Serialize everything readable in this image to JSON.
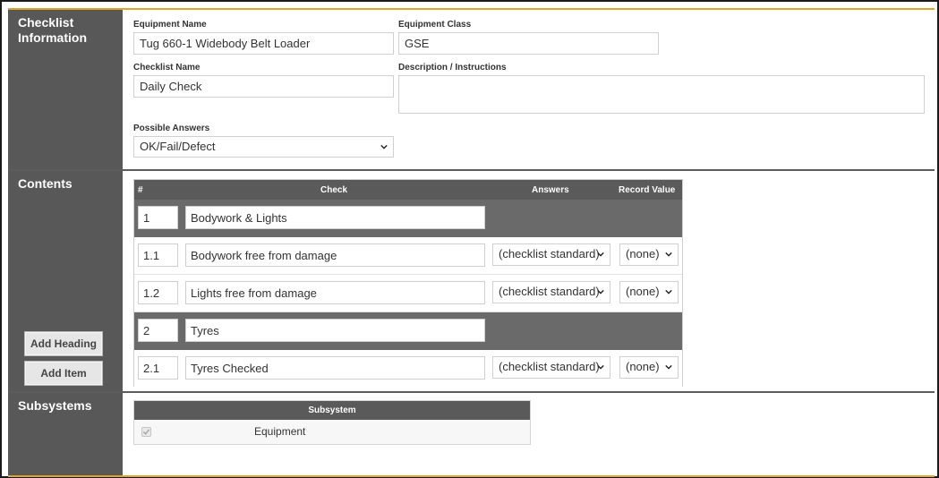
{
  "sections": {
    "checklist_info": {
      "title": "Checklist Information",
      "equipment_name": {
        "label": "Equipment Name",
        "value": "Tug 660-1 Widebody Belt Loader"
      },
      "equipment_class": {
        "label": "Equipment Class",
        "value": "GSE"
      },
      "checklist_name": {
        "label": "Checklist Name",
        "value": "Daily Check"
      },
      "description": {
        "label": "Description / Instructions",
        "value": ""
      },
      "possible_answers": {
        "label": "Possible Answers",
        "value": "OK/Fail/Defect"
      }
    },
    "contents": {
      "title": "Contents",
      "columns": {
        "num": "#",
        "check": "Check",
        "answers": "Answers",
        "record": "Record Value"
      },
      "rows": [
        {
          "type": "heading",
          "num": "1",
          "check": "Bodywork & Lights"
        },
        {
          "type": "item",
          "num": "1.1",
          "check": "Bodywork free from damage",
          "answers": "(checklist standard)",
          "record": "(none)"
        },
        {
          "type": "item",
          "num": "1.2",
          "check": "Lights free from damage",
          "answers": "(checklist standard)",
          "record": "(none)"
        },
        {
          "type": "heading",
          "num": "2",
          "check": "Tyres"
        },
        {
          "type": "item",
          "num": "2.1",
          "check": "Tyres Checked",
          "answers": "(checklist standard)",
          "record": "(none)"
        }
      ],
      "add_heading_label": "Add Heading",
      "add_item_label": "Add Item"
    },
    "subsystems": {
      "title": "Subsystems",
      "column": "Subsystem",
      "rows": [
        {
          "label": "Equipment",
          "checked": true
        }
      ]
    }
  },
  "colors": {
    "sidebar": "#585858",
    "accent": "#e0a526",
    "table_header": "#5a5a5a",
    "heading_row": "#6a6a6a"
  }
}
